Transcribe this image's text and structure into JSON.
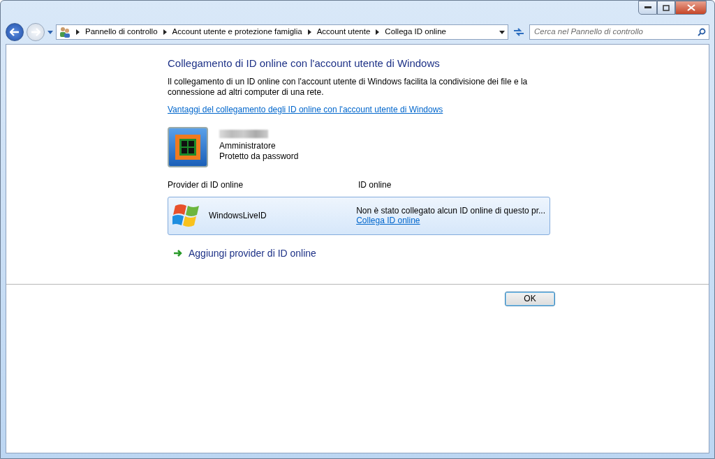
{
  "navigation": {
    "breadcrumbs": [
      "Pannello di controllo",
      "Account utente e protezione famiglia",
      "Account utente",
      "Collega ID online"
    ],
    "search": {
      "placeholder": "Cerca nel Pannello di controllo"
    }
  },
  "content": {
    "title": "Collegamento di ID online con l'account utente di Windows",
    "description": "Il collegamento di un ID online con l'account utente di Windows facilita la condivisione dei file e la connessione ad altri computer di una rete.",
    "help_link": "Vantaggi del collegamento degli ID online con l'account utente di Windows",
    "account": {
      "details": [
        "Amministratore",
        "Protetto da password"
      ]
    },
    "columns": [
      "Provider di ID online",
      "ID online"
    ],
    "providers": [
      {
        "name": "WindowsLiveID",
        "status": "Non è stato collegato alcun ID online di questo pr...",
        "link": "Collega ID online",
        "selected": true
      }
    ],
    "add_link": "Aggiungi provider di ID online"
  },
  "buttons": [
    "OK"
  ]
}
